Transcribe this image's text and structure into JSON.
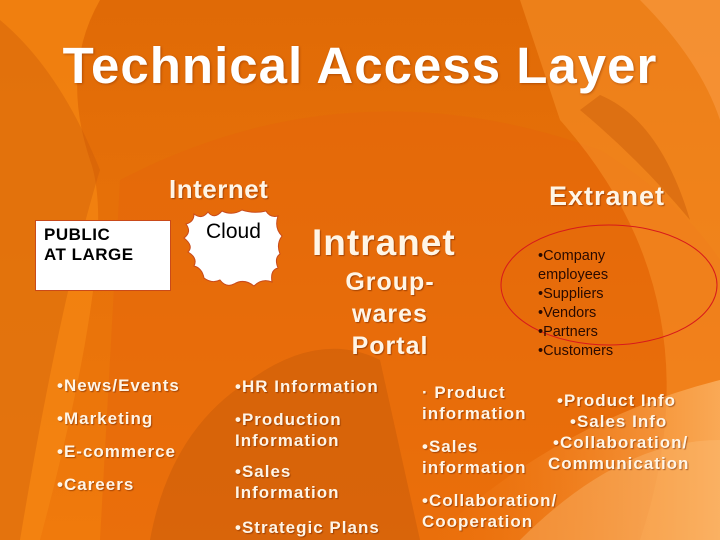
{
  "slide": {
    "title": "Technical Access Layer",
    "colors": {
      "background": "#e8670a",
      "text": "#fff5e6",
      "ellipse_stroke": "#d7191c",
      "dark_text": "#2a0a00"
    }
  },
  "internet": {
    "heading": "Internet",
    "public_box": {
      "line1": "PUBLIC",
      "line2": "AT LARGE"
    },
    "cloud_label": "Cloud",
    "items": [
      "•News/Events",
      "•Marketing",
      "•E-commerce",
      "•Careers"
    ]
  },
  "intranet": {
    "heading": "Intranet",
    "subheading_lines": [
      "Group-",
      "wares",
      "Portal"
    ],
    "items": [
      {
        "lines": [
          "•HR Information"
        ]
      },
      {
        "lines": [
          "•Production",
          "Information"
        ]
      },
      {
        "lines": [
          "•Sales",
          "Information"
        ]
      },
      {
        "lines": [
          "•Strategic Plans"
        ]
      }
    ]
  },
  "extranet": {
    "heading": "Extranet",
    "audience": [
      "•Company",
      "employees",
      "•Suppliers",
      "•Vendors",
      "•Partners",
      "•Customers"
    ],
    "items_left": [
      {
        "lines": [
          "· Product",
          "information"
        ]
      },
      {
        "lines": [
          "•Sales",
          "information"
        ]
      },
      {
        "lines": [
          "•Collaboration/",
          "Cooperation"
        ]
      }
    ],
    "items_right": [
      "•Product Info",
      "•Sales Info",
      "•Collaboration/",
      "Communication"
    ]
  }
}
